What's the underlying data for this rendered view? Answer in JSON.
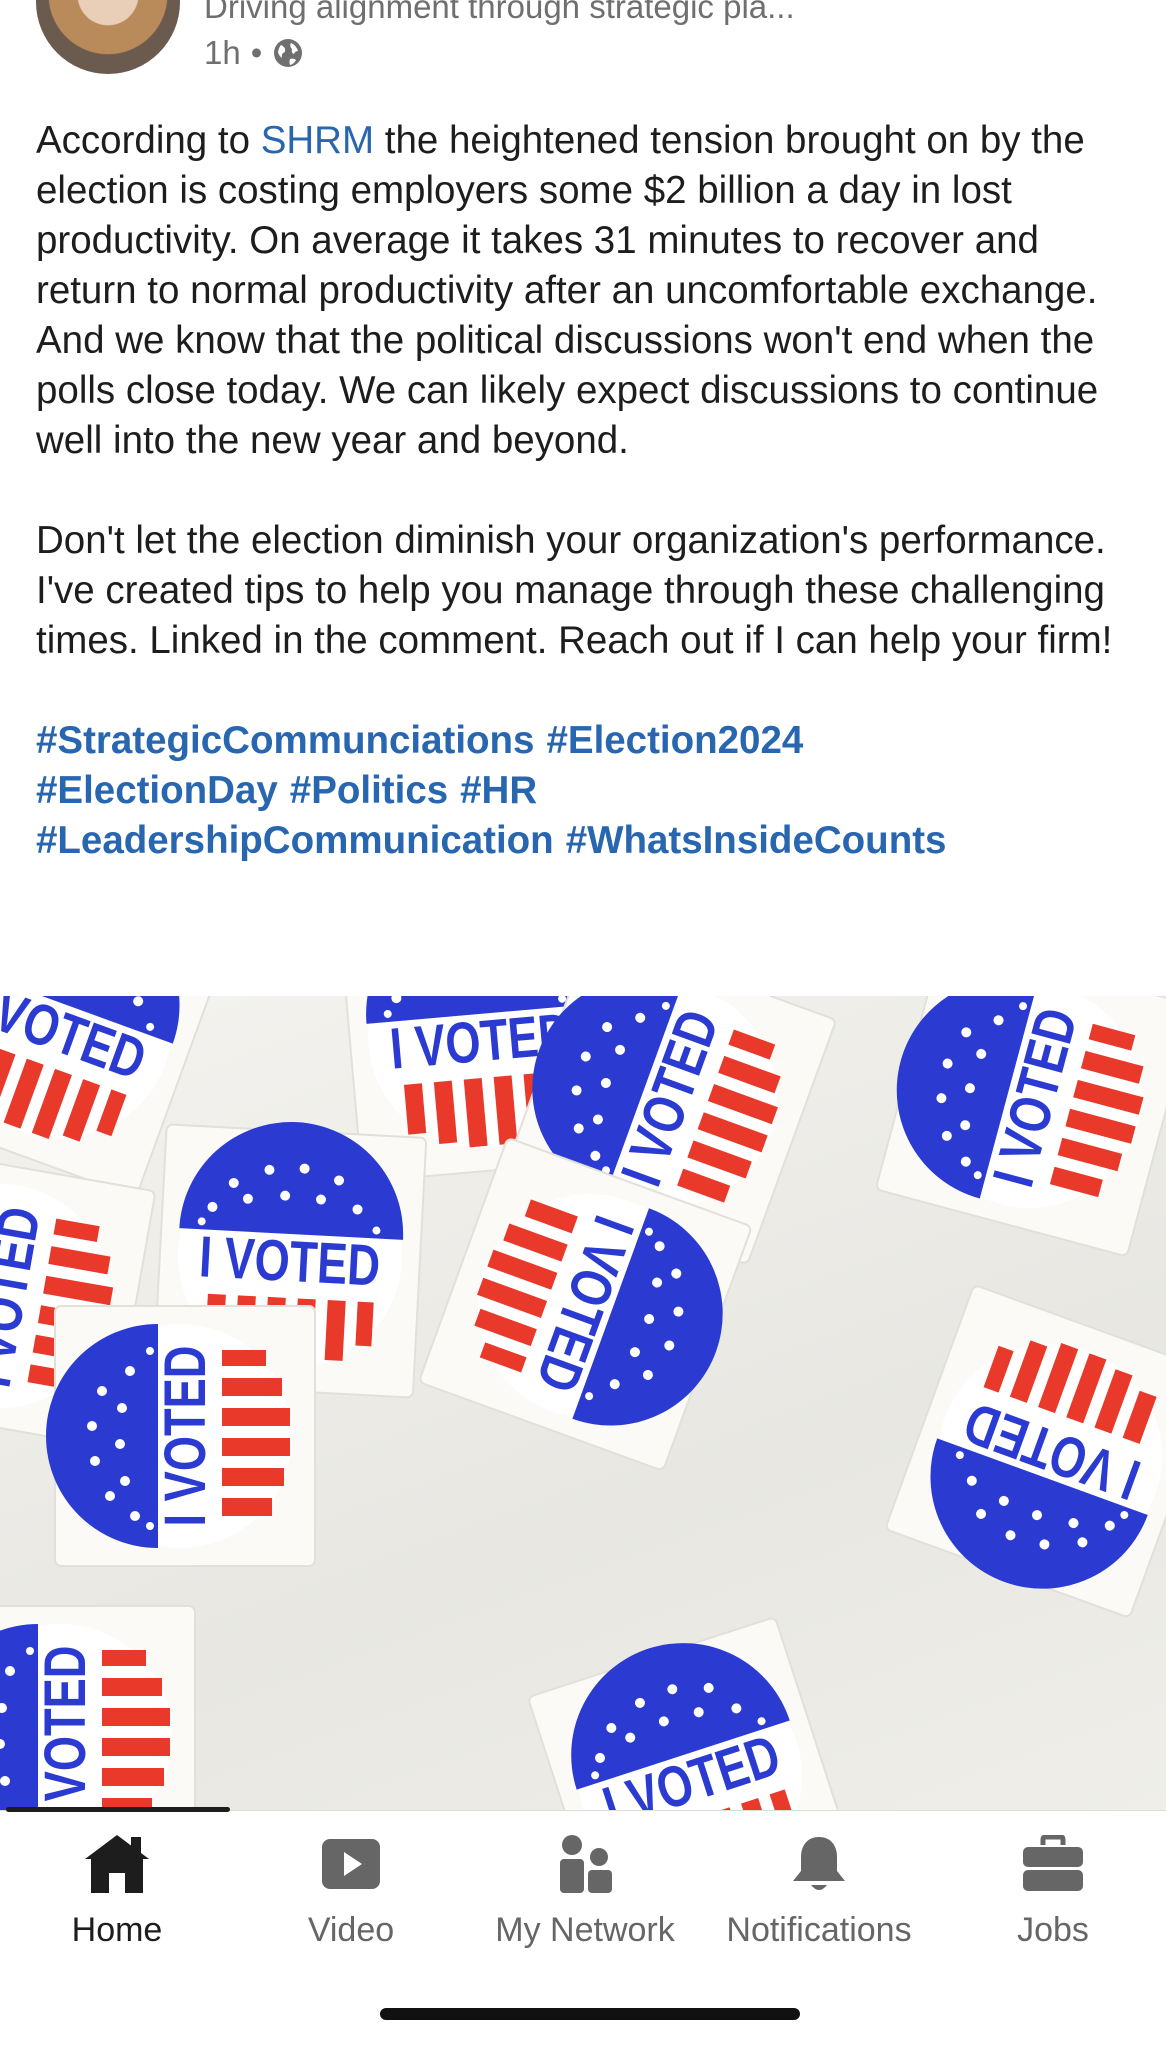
{
  "post": {
    "author_headline": "Driving alignment through strategic pla...",
    "timestamp": "1h",
    "separator": "•",
    "visibility_icon": "globe-icon",
    "paragraph1_before_mention": "According to ",
    "mention": "SHRM",
    "paragraph1_after_mention": " the heightened tension brought on by the election is  costing employers some $2 billion a day in lost productivity. On average it takes 31 minutes to recover and return to normal productivity after an uncomfortable exchange.  And we know that the political discussions won't end when the polls close today. We can likely expect discussions to continue well into the new year and beyond.",
    "paragraph2": "Don't let the election diminish your organization's performance.  I've created tips to help you manage through these challenging times. Linked in the comment. Reach out if I can help your firm!",
    "hashtags": [
      "#StrategicCommunciations",
      "#Election2024",
      "#ElectionDay",
      "#Politics",
      "#HR",
      "#LeadershipCommunication",
      "#WhatsInsideCounts"
    ],
    "image": {
      "sticker_text": "I VOTED",
      "colors": {
        "blue": "#2b3bd1",
        "red": "#e8392b",
        "paper": "#f7f6f2"
      }
    }
  },
  "tabbar": {
    "active_color": "#1d1d1d",
    "inactive_color": "#666666",
    "tabs": [
      {
        "label": "Home",
        "icon": "home-icon",
        "active": true
      },
      {
        "label": "Video",
        "icon": "video-play-icon",
        "active": false
      },
      {
        "label": "My Network",
        "icon": "my-network-icon",
        "active": false
      },
      {
        "label": "Notifications",
        "icon": "bell-icon",
        "active": false
      },
      {
        "label": "Jobs",
        "icon": "briefcase-icon",
        "active": false
      }
    ]
  },
  "colors": {
    "link": "#2866b0",
    "text": "#1d1d1d",
    "muted": "#6f6f6f"
  }
}
